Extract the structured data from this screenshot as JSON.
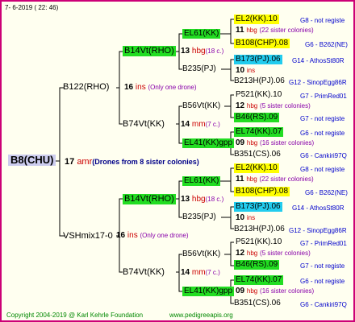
{
  "header": "7-  6-2019 ( 22: 46)",
  "footer": {
    "copyright": "Copyright 2004-2019 @ Karl Kehrle Foundation",
    "site": "www.pedigreeapis.org"
  },
  "root": {
    "name": "B8(CHU)",
    "num": "17",
    "unit": "amr",
    "note": "(Drones from 8 sister colonies)"
  },
  "q1": {
    "name": "B122(RHO)",
    "num": "16",
    "unit": "ins",
    "note": "(Only one drone)"
  },
  "q2": {
    "name": "VSHmix17-0",
    "num": "16",
    "unit": "ins",
    "note": "(Only one drone)"
  },
  "g": {
    "a1": {
      "name": "B14Vt(RHO)",
      "num": "13",
      "unit": "hbg",
      "note": "(18 c.)"
    },
    "a2": {
      "name": "B74Vt(KK)",
      "num": "14",
      "unit": "mm",
      "note": "(7 c.)"
    },
    "b1": {
      "name": "B14Vt(RHO)",
      "num": "13",
      "unit": "hbg",
      "note": "(18 c.)"
    },
    "b2": {
      "name": "B74Vt(KK)",
      "num": "14",
      "unit": "mm",
      "note": "(7 c.)"
    }
  },
  "gg": {
    "a1": {
      "name": "EL61(KK)",
      "drone": "B235(PJ)"
    },
    "a2": {
      "name": "B56Vt(KK)",
      "drone": "EL41(KK)gpp"
    },
    "b1": {
      "name": "EL61(KK)",
      "drone": "B235(PJ)"
    },
    "b2": {
      "name": "B56Vt(KK)",
      "drone": "EL41(KK)gpp"
    }
  },
  "leaves": {
    "a1": [
      {
        "name": "EL2(KK).10",
        "code": "G8 - not registe"
      },
      {
        "num": "11",
        "unit": "hbg",
        "note": "(22 sister colonies)"
      },
      {
        "name": "B108(CHP).08",
        "code": "G6 - B262(NE)"
      },
      {
        "name": "B173(PJ).06",
        "code": "G14 - AthosSt80R"
      },
      {
        "num": "10",
        "unit": "ins"
      },
      {
        "name": "B213H(PJ).06",
        "code": "G12 - SinopEgg86R"
      }
    ],
    "a2": [
      {
        "name": "P521(KK).10",
        "code": "G7 - PrimRed01"
      },
      {
        "num": "12",
        "unit": "hbg",
        "note": "(5 sister colonies)"
      },
      {
        "name": "B46(RS).09",
        "code": "G7 - not registe"
      },
      {
        "name": "EL74(KK).07",
        "code": "G6 - not registe"
      },
      {
        "num": "09",
        "unit": "hbg",
        "note": "(16 sister colonies)"
      },
      {
        "name": "B351(CS).06",
        "code": "G6 - Cankiri97Q"
      }
    ],
    "b1": [
      {
        "name": "EL2(KK).10",
        "code": "G8 - not registe"
      },
      {
        "num": "11",
        "unit": "hbg",
        "note": "(22 sister colonies)"
      },
      {
        "name": "B108(CHP).08",
        "code": "G6 - B262(NE)"
      },
      {
        "name": "B173(PJ).06",
        "code": "G14 - AthosSt80R"
      },
      {
        "num": "10",
        "unit": "ins"
      },
      {
        "name": "B213H(PJ).06",
        "code": "G12 - SinopEgg86R"
      }
    ],
    "b2": [
      {
        "name": "P521(KK).10",
        "code": "G7 - PrimRed01"
      },
      {
        "num": "12",
        "unit": "hbg",
        "note": "(5 sister colonies)"
      },
      {
        "name": "B46(RS).09",
        "code": "G7 - not registe"
      },
      {
        "name": "EL74(KK).07",
        "code": "G6 - not registe"
      },
      {
        "num": "09",
        "unit": "hbg",
        "note": "(16 sister colonies)"
      },
      {
        "name": "B351(CS).06",
        "code": "G6 - Cankiri97Q"
      }
    ]
  }
}
